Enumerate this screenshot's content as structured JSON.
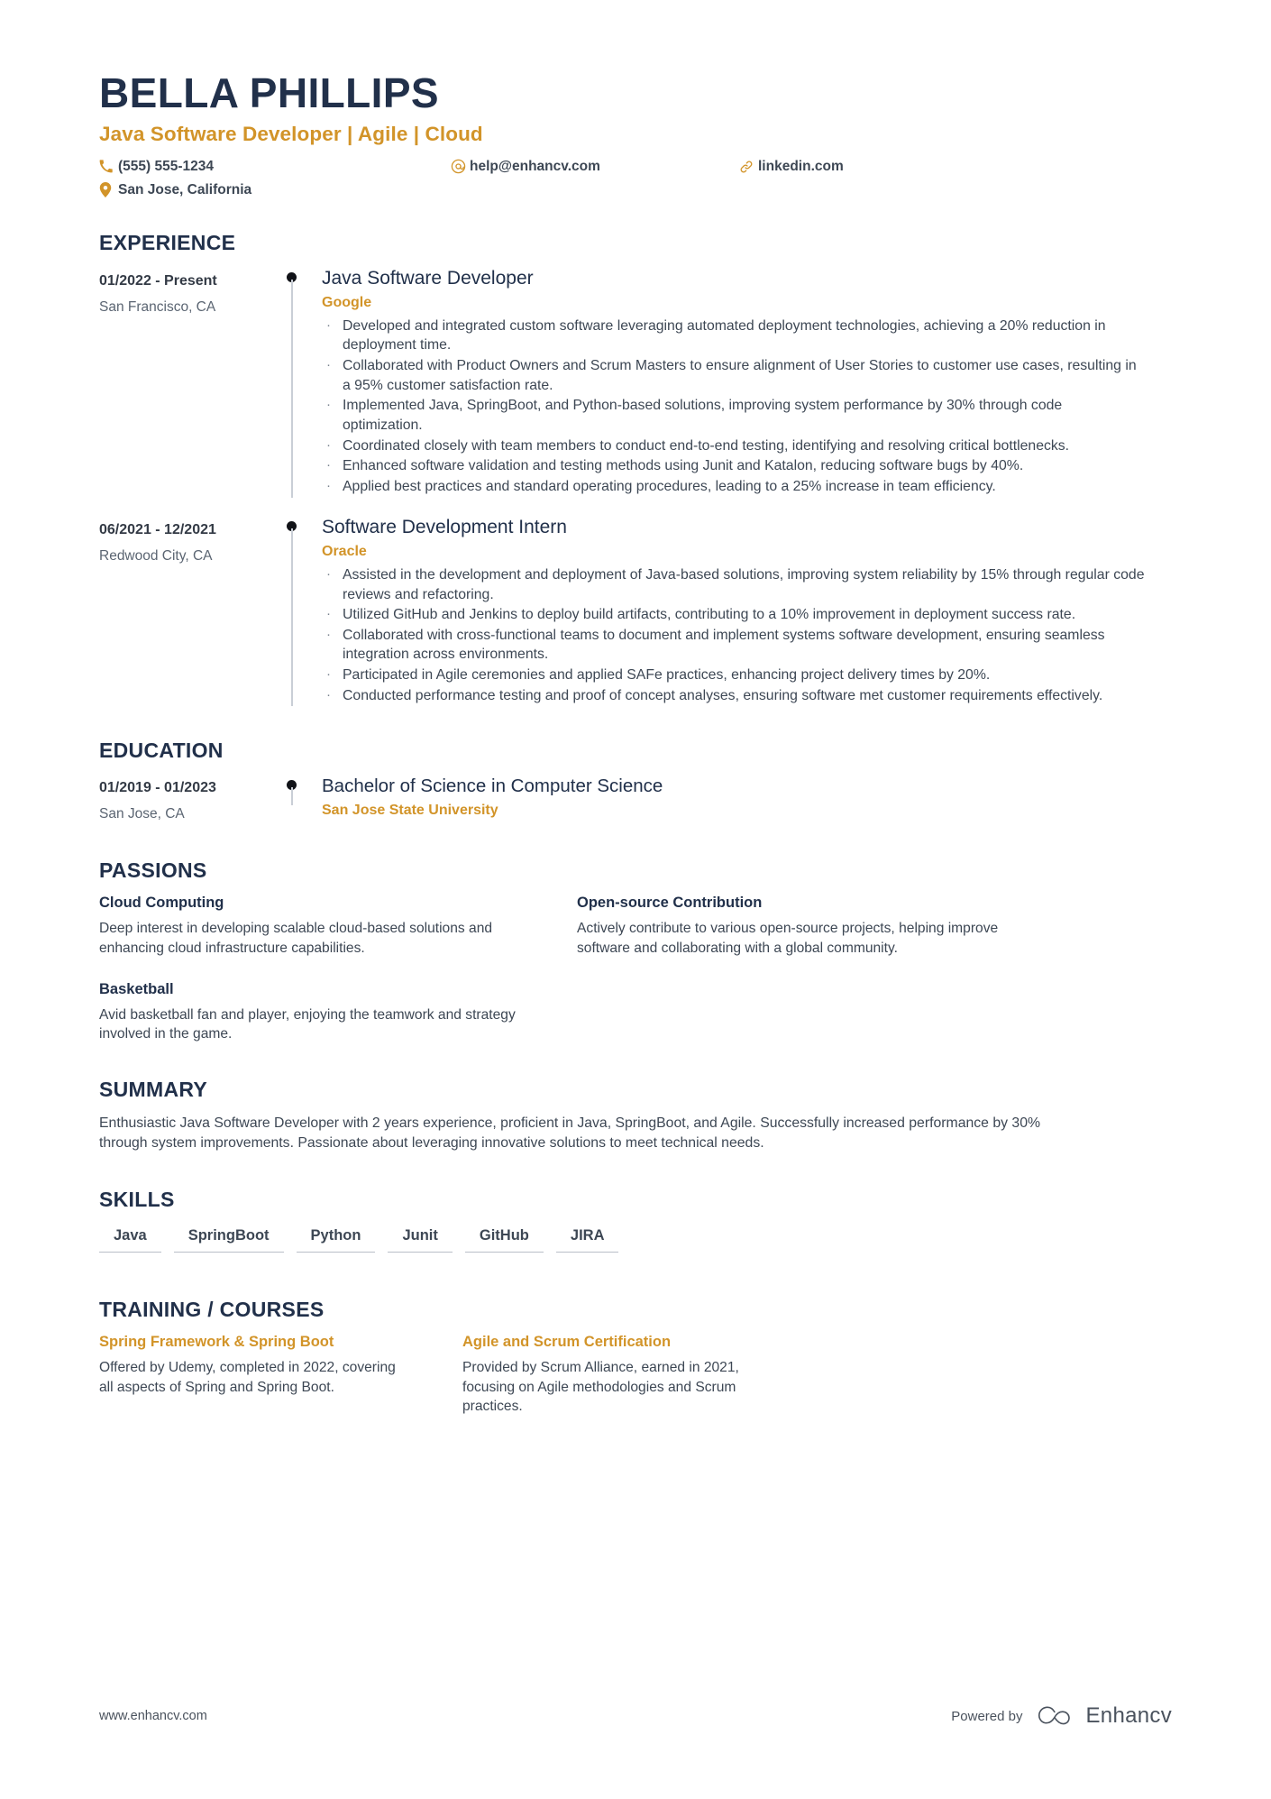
{
  "header": {
    "name": "BELLA PHILLIPS",
    "job_title": "Java Software Developer | Agile | Cloud",
    "contacts": [
      {
        "icon": "phone-icon",
        "value": "(555) 555-1234"
      },
      {
        "icon": "email-icon",
        "value": "help@enhancv.com"
      },
      {
        "icon": "link-icon",
        "value": "linkedin.com"
      },
      {
        "icon": "location-pin-icon",
        "value": "San Jose, California"
      }
    ]
  },
  "experience": {
    "title": "EXPERIENCE",
    "entries": [
      {
        "date": "01/2022 - Present",
        "location": "San Francisco, CA",
        "role": "Java Software Developer",
        "company": "Google",
        "bullets": [
          "Developed and integrated custom software leveraging automated deployment technologies, achieving a 20% reduction in deployment time.",
          "Collaborated with Product Owners and Scrum Masters to ensure alignment of User Stories to customer use cases, resulting in a 95% customer satisfaction rate.",
          "Implemented Java, SpringBoot, and Python-based solutions, improving system performance by 30% through code optimization.",
          "Coordinated closely with team members to conduct end-to-end testing, identifying and resolving critical bottlenecks.",
          "Enhanced software validation and testing methods using Junit and Katalon, reducing software bugs by 40%.",
          "Applied best practices and standard operating procedures, leading to a 25% increase in team efficiency."
        ]
      },
      {
        "date": "06/2021 - 12/2021",
        "location": "Redwood City, CA",
        "role": "Software Development Intern",
        "company": "Oracle",
        "bullets": [
          "Assisted in the development and deployment of Java-based solutions, improving system reliability by 15% through regular code reviews and refactoring.",
          "Utilized GitHub and Jenkins to deploy build artifacts, contributing to a 10% improvement in deployment success rate.",
          "Collaborated with cross-functional teams to document and implement systems software development, ensuring seamless integration across environments.",
          "Participated in Agile ceremonies and applied SAFe practices, enhancing project delivery times by 20%.",
          "Conducted performance testing and proof of concept analyses, ensuring software met customer requirements effectively."
        ]
      }
    ]
  },
  "education": {
    "title": "EDUCATION",
    "entries": [
      {
        "date": "01/2019 - 01/2023",
        "location": "San Jose, CA",
        "degree": "Bachelor of Science in Computer Science",
        "school": "San Jose State University"
      }
    ]
  },
  "passions": {
    "title": "PASSIONS",
    "items": [
      {
        "name": "Cloud Computing",
        "text": "Deep interest in developing scalable cloud-based solutions and enhancing cloud infrastructure capabilities."
      },
      {
        "name": "Open-source Contribution",
        "text": "Actively contribute to various open-source projects, helping improve software and collaborating with a global community."
      },
      {
        "name": "Basketball",
        "text": "Avid basketball fan and player, enjoying the teamwork and strategy involved in the game."
      }
    ]
  },
  "summary": {
    "title": "SUMMARY",
    "text": "Enthusiastic Java Software Developer with 2 years experience, proficient in Java, SpringBoot, and Agile. Successfully increased performance by 30% through system improvements. Passionate about leveraging innovative solutions to meet technical needs."
  },
  "skills": {
    "title": "SKILLS",
    "items": [
      "Java",
      "SpringBoot",
      "Python",
      "Junit",
      "GitHub",
      "JIRA"
    ]
  },
  "training": {
    "title": "TRAINING / COURSES",
    "items": [
      {
        "name": "Spring Framework & Spring Boot",
        "text": "Offered by Udemy, completed in 2022, covering all aspects of Spring and Spring Boot."
      },
      {
        "name": "Agile and Scrum Certification",
        "text": "Provided by Scrum Alliance, earned in 2021, focusing on Agile methodologies and Scrum practices."
      }
    ]
  },
  "footer": {
    "url": "www.enhancv.com",
    "powered_by": "Powered by",
    "brand": "Enhancv"
  },
  "colors": {
    "accent": "#d29429",
    "heading": "#21304a",
    "body": "#3d4754"
  }
}
